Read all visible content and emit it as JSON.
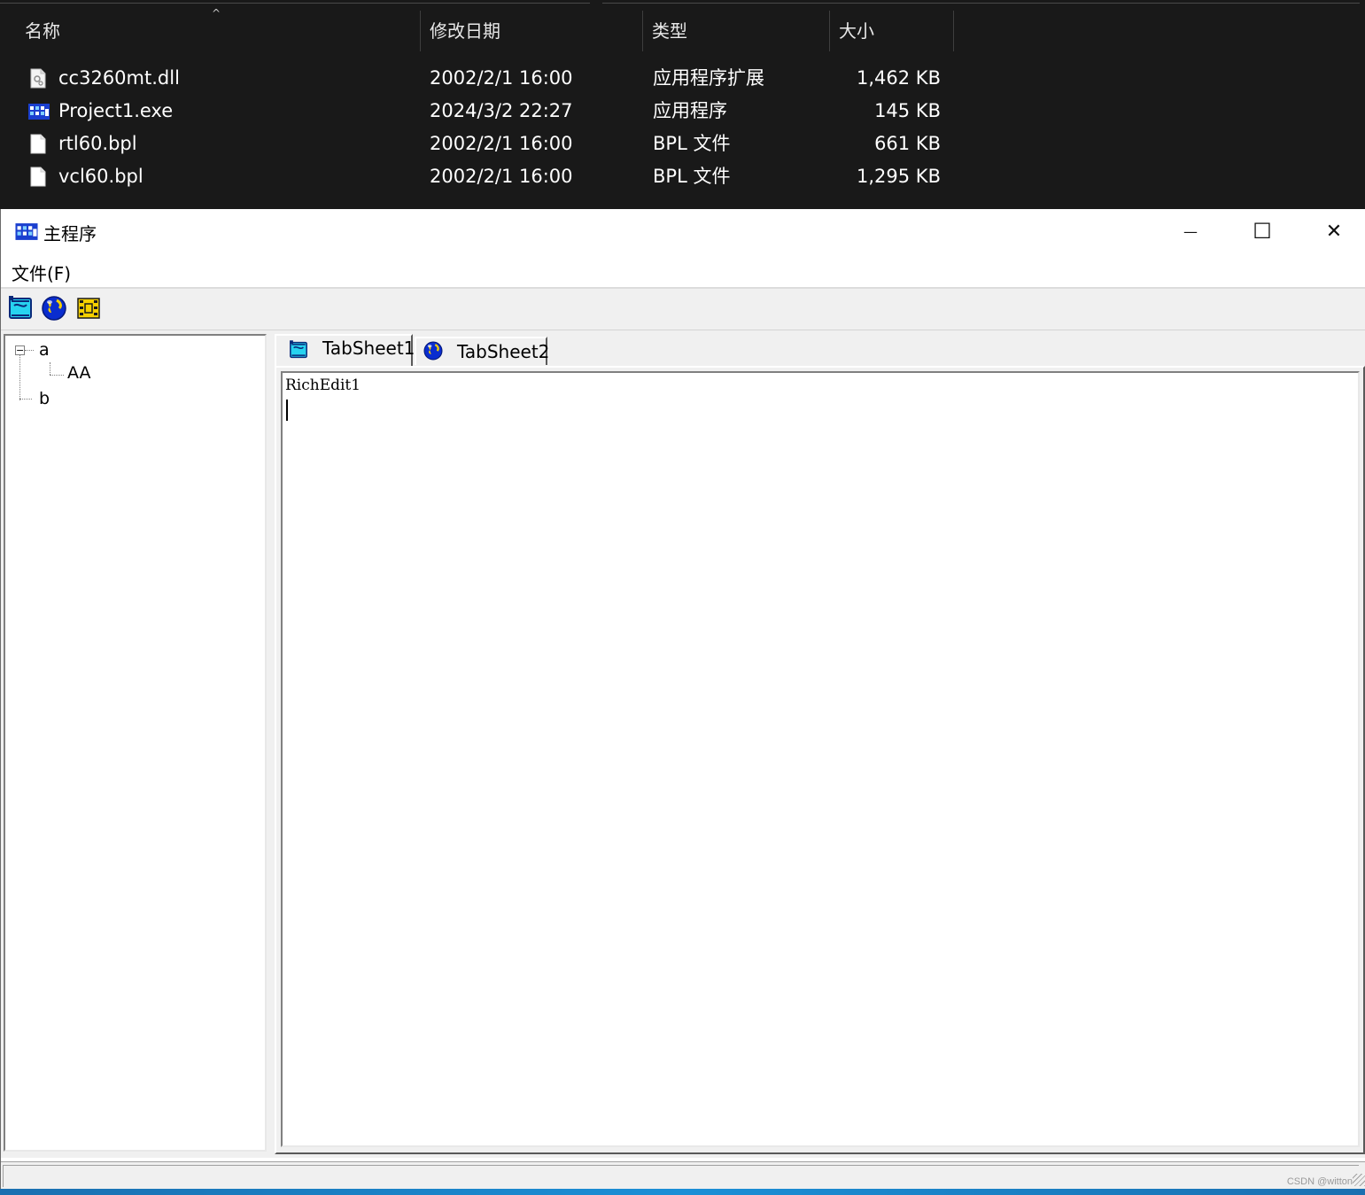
{
  "explorer": {
    "columns": {
      "name": "名称",
      "modified": "修改日期",
      "type": "类型",
      "size": "大小"
    },
    "sort_indicator": "^",
    "files": [
      {
        "name": "cc3260mt.dll",
        "modified": "2002/2/1 16:00",
        "type": "应用程序扩展",
        "size": "1,462 KB",
        "icon": "dll-file-icon"
      },
      {
        "name": "Project1.exe",
        "modified": "2024/3/2 22:27",
        "type": "应用程序",
        "size": "145 KB",
        "icon": "exe-app-icon"
      },
      {
        "name": "rtl60.bpl",
        "modified": "2002/2/1 16:00",
        "type": "BPL 文件",
        "size": "661 KB",
        "icon": "blank-file-icon"
      },
      {
        "name": "vcl60.bpl",
        "modified": "2002/2/1 16:00",
        "type": "BPL 文件",
        "size": "1,295 KB",
        "icon": "blank-file-icon"
      }
    ]
  },
  "window": {
    "title": "主程序",
    "minimize_glyph": "—",
    "maximize_glyph": "☐",
    "close_glyph": "✕"
  },
  "menu": {
    "file": "文件(F)"
  },
  "toolbar": {
    "buttons": [
      "new-icon",
      "globe-icon",
      "film-icon"
    ]
  },
  "tree": {
    "nodes": [
      {
        "label": "a",
        "expanded": true,
        "children": [
          {
            "label": "AA"
          }
        ]
      },
      {
        "label": "b"
      }
    ],
    "expander_glyph": "−"
  },
  "tabs": {
    "items": [
      {
        "label": "TabSheet1",
        "icon": "new-icon",
        "active": true
      },
      {
        "label": "TabSheet2",
        "icon": "globe-icon",
        "active": false
      }
    ]
  },
  "richedit": {
    "text": "RichEdit1"
  },
  "status": {
    "watermark": "CSDN @witton"
  },
  "colors": {
    "explorer_bg": "#191919",
    "window_bg": "#ffffff",
    "face": "#f0f0f0",
    "taskbar": "#1b8fd6"
  }
}
